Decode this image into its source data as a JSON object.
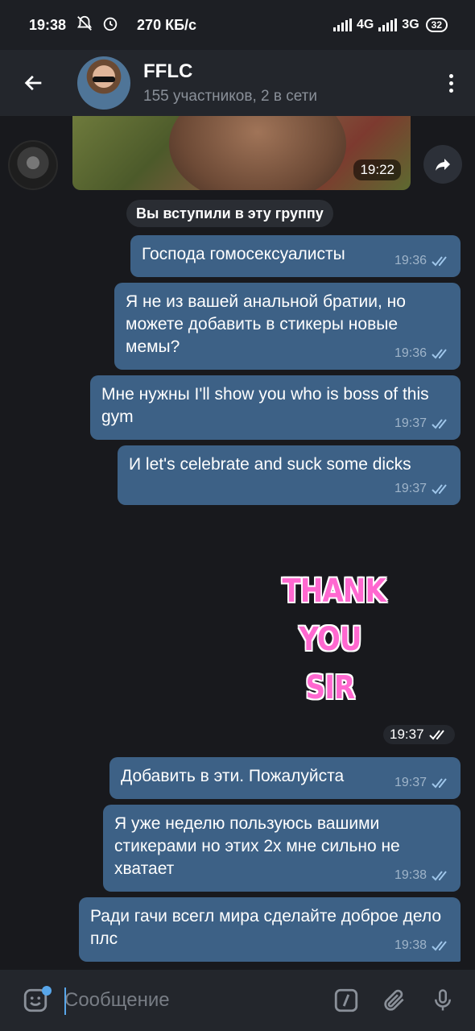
{
  "status_bar": {
    "time": "19:38",
    "speed": "270 КБ/с",
    "net1": "4G",
    "net2": "3G",
    "battery": "32"
  },
  "header": {
    "title": "FFLC",
    "subtitle": "155 участников, 2 в сети"
  },
  "chat": {
    "photo_time": "19:22",
    "service_message": "Вы вступили в эту группу",
    "messages": [
      {
        "text": "Господа гомосексуалисты",
        "time": "19:36"
      },
      {
        "text": "Я не из вашей анальной братии, но можете добавить в стикеры новые мемы?",
        "time": "19:36"
      },
      {
        "text": "Мне нужны I'll show you who is boss of this gym",
        "time": "19:37"
      },
      {
        "text": "И let's celebrate and suck some dicks",
        "time": "19:37"
      }
    ],
    "sticker": {
      "line1": "THANK",
      "line2": "YOU",
      "line3": "SIR",
      "time": "19:37"
    },
    "messages2": [
      {
        "text": "Добавить в эти. Пожалуйста",
        "time": "19:37"
      },
      {
        "text": "Я уже неделю пользуюсь вашими стикерами но этих 2х мне сильно не хватает",
        "time": "19:38"
      },
      {
        "text": "Ради гачи всегл мира сделайте доброе дело плс",
        "time": "19:38"
      }
    ]
  },
  "input": {
    "placeholder": "Сообщение"
  },
  "colors": {
    "bubble_out": "#3d6186",
    "background": "#18191d",
    "header": "#23262c",
    "accent": "#58a6ea"
  }
}
